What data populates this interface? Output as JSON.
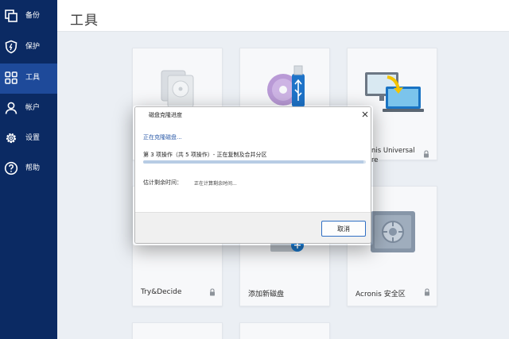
{
  "sidebar": {
    "items": [
      {
        "label": "备份",
        "icon": "backup-icon"
      },
      {
        "label": "保护",
        "icon": "shield-icon"
      },
      {
        "label": "工具",
        "icon": "grid-icon",
        "active": true
      },
      {
        "label": "帐户",
        "icon": "user-icon"
      },
      {
        "label": "设置",
        "icon": "gear-icon"
      },
      {
        "label": "帮助",
        "icon": "help-icon"
      }
    ]
  },
  "header": {
    "title": "工具"
  },
  "cards": [
    {
      "label": "",
      "art": "disk-drives"
    },
    {
      "label": "",
      "art": "bootable-media"
    },
    {
      "label": "nis Universal\nre",
      "art": "universal-restore",
      "locked": true
    },
    {
      "label": "Try&Decide",
      "art": "try-decide",
      "locked": true
    },
    {
      "label": "添加新磁盘",
      "art": "add-disk"
    },
    {
      "label": "Acronis 安全区",
      "art": "secure-zone",
      "locked": true
    }
  ],
  "dialog": {
    "title": "磁盘克隆进度",
    "status": "正在克隆磁盘...",
    "operation": "第 3 项操作（共 5 项操作）- 正在复制及合并分区",
    "progress": 0.99,
    "eta_label": "估计剩余时间：",
    "eta_value": "正在计算剩余时间...",
    "cancel_label": "取消"
  },
  "colors": {
    "sidebar_bg": "#0b2a63",
    "sidebar_active": "#1e4a9a",
    "accent": "#2f6fc4",
    "link": "#2b5aa8"
  }
}
